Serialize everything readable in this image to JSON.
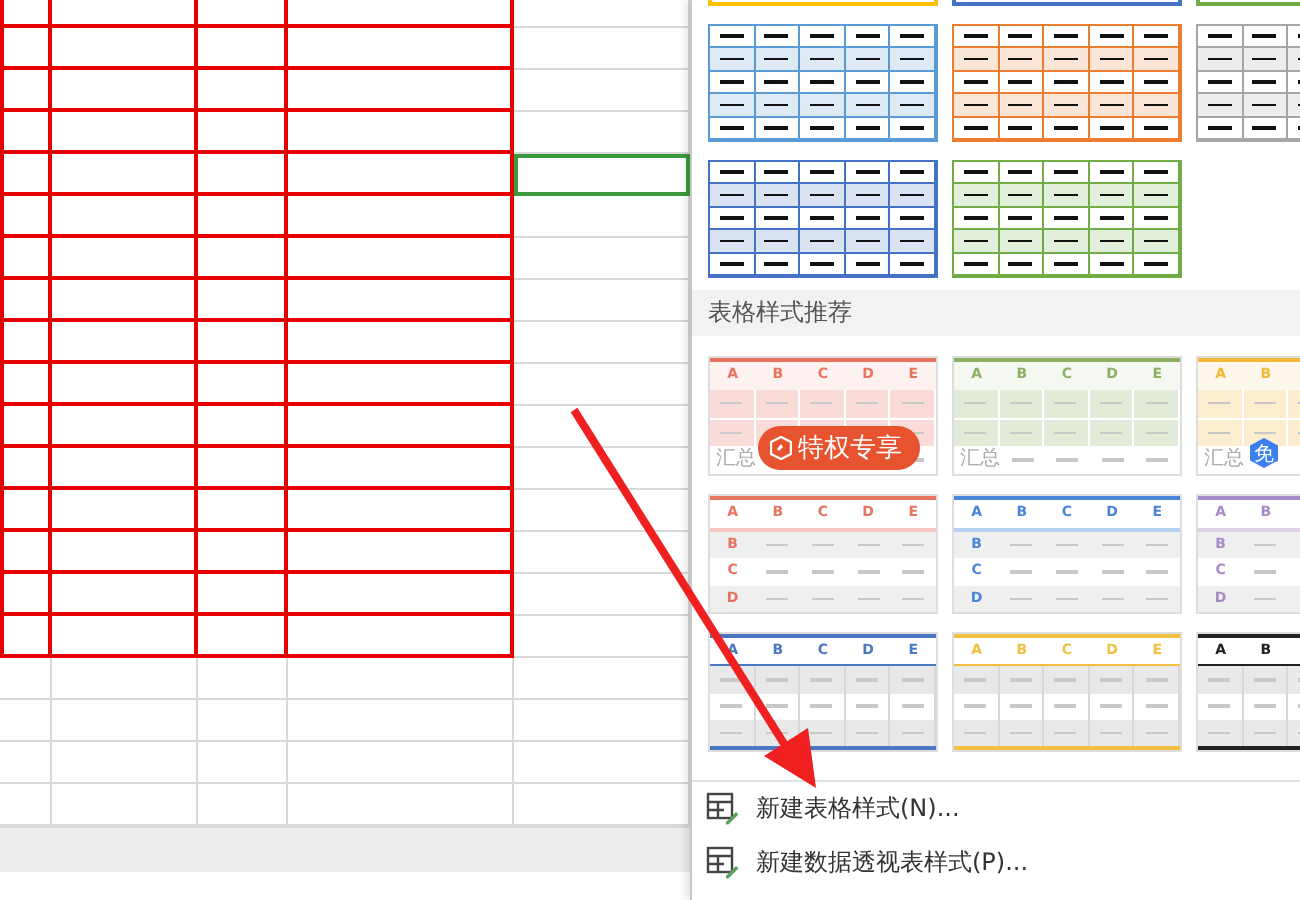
{
  "sheet": {
    "rows": [
      {
        "in_table": true,
        "selected_cell": false
      },
      {
        "in_table": true,
        "selected_cell": false
      },
      {
        "in_table": true,
        "selected_cell": false
      },
      {
        "in_table": true,
        "selected_cell": false
      },
      {
        "in_table": true,
        "selected_cell": true
      },
      {
        "in_table": true,
        "selected_cell": false
      },
      {
        "in_table": true,
        "selected_cell": false
      },
      {
        "in_table": true,
        "selected_cell": false
      },
      {
        "in_table": true,
        "selected_cell": false
      },
      {
        "in_table": true,
        "selected_cell": false
      },
      {
        "in_table": true,
        "selected_cell": false
      },
      {
        "in_table": true,
        "selected_cell": false
      },
      {
        "in_table": true,
        "selected_cell": false
      },
      {
        "in_table": true,
        "selected_cell": false
      },
      {
        "in_table": true,
        "selected_cell": false
      },
      {
        "in_table": true,
        "selected_cell": false
      },
      {
        "in_table": false,
        "selected_cell": false
      },
      {
        "in_table": false,
        "selected_cell": false
      },
      {
        "in_table": false,
        "selected_cell": false
      },
      {
        "in_table": false,
        "selected_cell": false
      }
    ]
  },
  "annotation": {
    "kind": "arrow"
  },
  "style_panel": {
    "gallery": [
      [
        {
          "kind": "clipped",
          "color": "#ffc000"
        },
        {
          "kind": "clipped",
          "color": "#4472c4"
        },
        {
          "kind": "clipped",
          "color": "#70ad47"
        }
      ],
      [
        {
          "kind": "banded",
          "color": "#5b9bd5"
        },
        {
          "kind": "banded",
          "color": "#ed7d31"
        },
        {
          "kind": "banded",
          "color": "#a5a5a5"
        }
      ],
      [
        {
          "kind": "banded",
          "color": "#4472c4"
        },
        {
          "kind": "banded",
          "color": "#70ad47"
        }
      ]
    ],
    "section_title": "表格样式推荐",
    "recommended": [
      [
        {
          "kind": "summary",
          "color": "#e8735f",
          "headers": [
            "A",
            "B",
            "C",
            "D",
            "E"
          ],
          "footer": "汇总",
          "badge": {
            "kind": "premium",
            "label": "特权专享"
          }
        },
        {
          "kind": "summary",
          "color": "#8cb064",
          "headers": [
            "A",
            "B",
            "C",
            "D",
            "E"
          ],
          "footer": "汇总"
        },
        {
          "kind": "summary",
          "color": "#f0b93a",
          "headers": [
            "A",
            "B"
          ],
          "footer": "汇总",
          "badge": {
            "kind": "free",
            "label": "免"
          }
        }
      ],
      [
        {
          "kind": "row_header",
          "color": "#e8735f",
          "headers": [
            "A",
            "B",
            "C",
            "D",
            "E"
          ],
          "row_labels": [
            "B",
            "C",
            "D"
          ]
        },
        {
          "kind": "row_header",
          "color": "#4a86d8",
          "headers": [
            "A",
            "B",
            "C",
            "D",
            "E"
          ],
          "row_labels": [
            "B",
            "C",
            "D"
          ]
        },
        {
          "kind": "row_header",
          "color": "#a78bc8",
          "headers": [
            "A",
            "B"
          ],
          "row_labels": [
            "B",
            "C",
            "D"
          ]
        }
      ],
      [
        {
          "kind": "column",
          "color": "#4a78c0",
          "headers": [
            "A",
            "B",
            "C",
            "D",
            "E"
          ]
        },
        {
          "kind": "column",
          "color": "#f0c040",
          "headers": [
            "A",
            "B",
            "C",
            "D",
            "E"
          ]
        },
        {
          "kind": "column",
          "color": "#222222",
          "headers": [
            "A",
            "B"
          ]
        }
      ]
    ],
    "menu": [
      {
        "label": "新建表格样式(N)..."
      },
      {
        "label": "新建数据透视表样式(P)..."
      }
    ]
  }
}
